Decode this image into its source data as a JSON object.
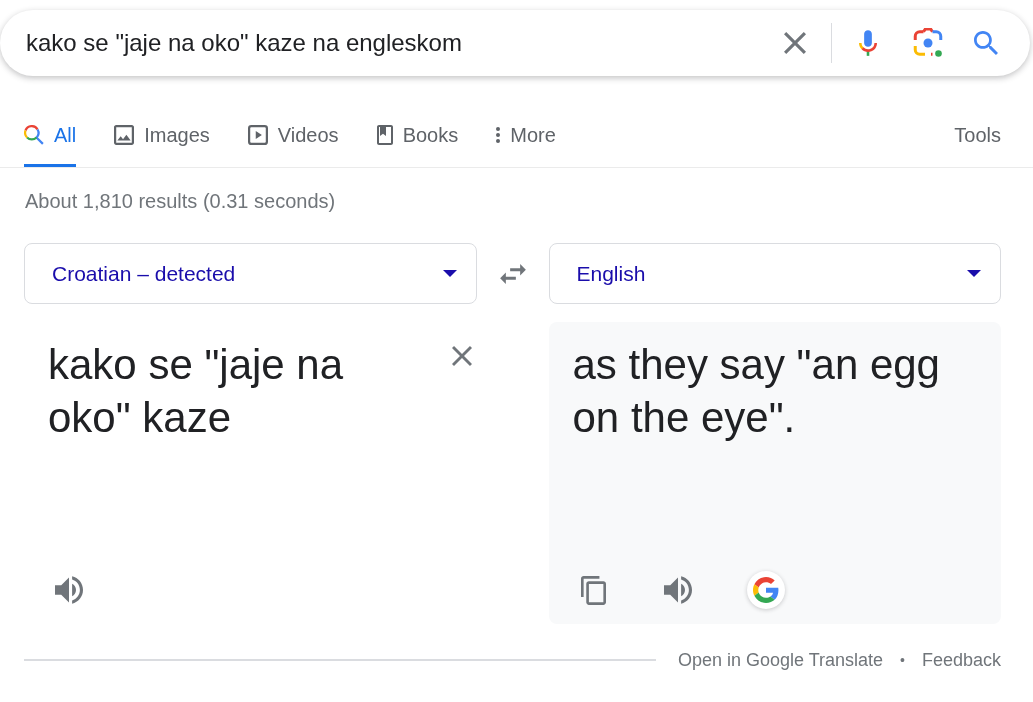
{
  "search": {
    "query": "kako se \"jaje na oko\" kaze na engleskom"
  },
  "tabs": [
    {
      "label": "All",
      "kind": "all",
      "selected": true
    },
    {
      "label": "Images",
      "kind": "images",
      "selected": false
    },
    {
      "label": "Videos",
      "kind": "videos",
      "selected": false
    },
    {
      "label": "Books",
      "kind": "books",
      "selected": false
    },
    {
      "label": "More",
      "kind": "more",
      "selected": false
    }
  ],
  "tools": "Tools",
  "result_stats": "About 1,810 results (0.31 seconds)",
  "translator": {
    "source_language": "Croatian – detected",
    "target_language": "English",
    "source_text": "kako se \"jaje na oko\" kaze",
    "translation": "as they say \"an egg on the eye\"."
  },
  "footer": {
    "open_link": "Open in Google Translate",
    "separator": "•",
    "feedback_link": "Feedback"
  }
}
